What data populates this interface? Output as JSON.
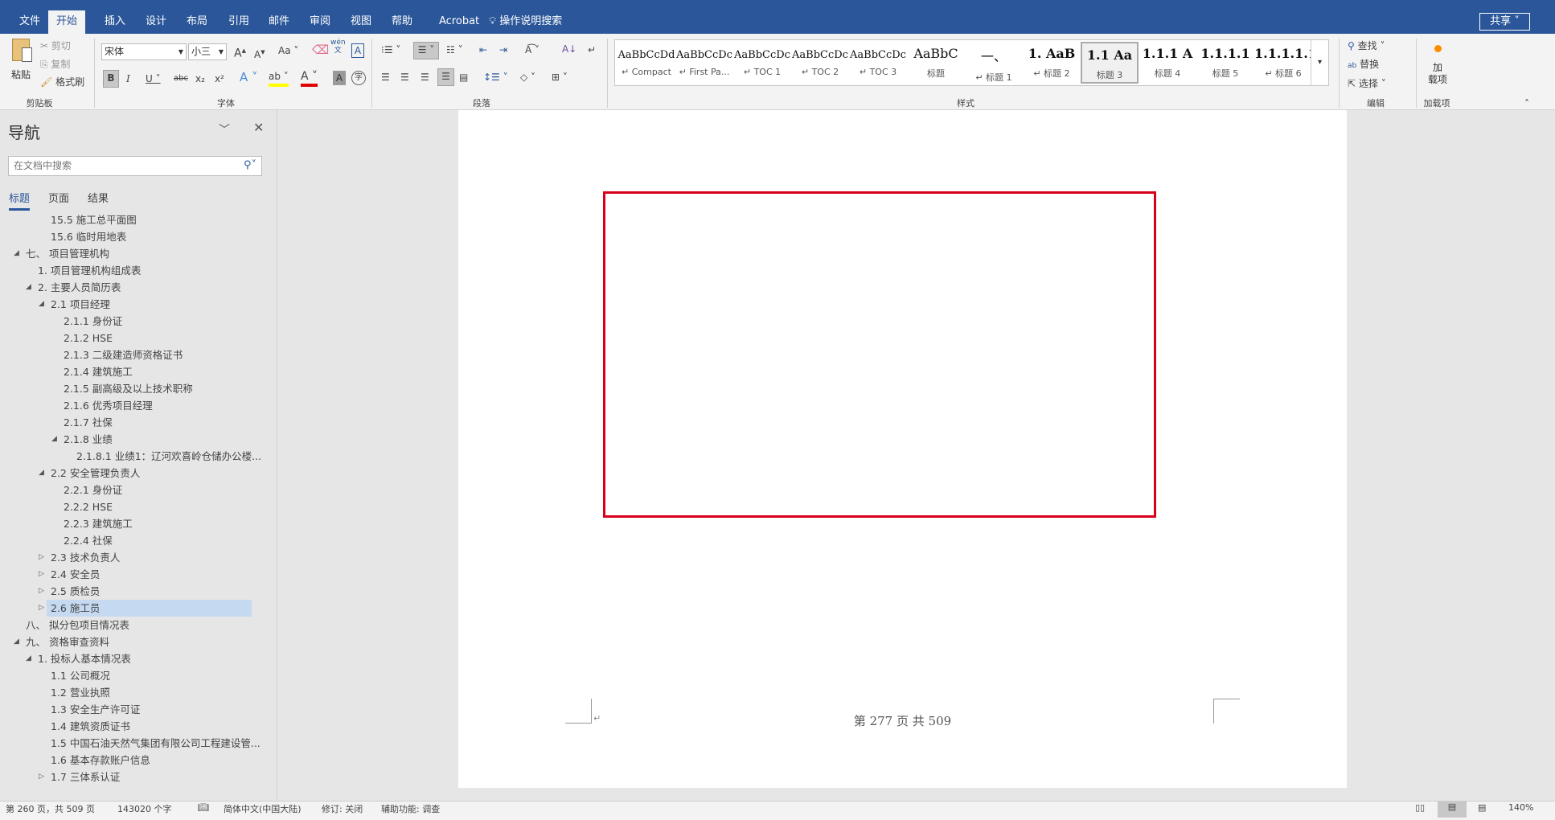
{
  "ribbon_tabs": [
    "文件",
    "开始",
    "插入",
    "设计",
    "布局",
    "引用",
    "邮件",
    "审阅",
    "视图",
    "帮助",
    "Acrobat"
  ],
  "active_tab": "开始",
  "tell_me": "操作说明搜索",
  "share": "共享",
  "clipboard": {
    "paste": "粘贴",
    "cut": "剪切",
    "copy": "复制",
    "format_painter": "格式刷",
    "label": "剪贴板"
  },
  "font": {
    "name": "宋体",
    "size": "小三",
    "change_case": "Aa",
    "label": "字体",
    "bold": "B",
    "italic": "I",
    "underline": "U",
    "strike": "abc",
    "sub": "x₂",
    "sup": "x²",
    "phonetic": "wén"
  },
  "paragraph": {
    "label": "段落"
  },
  "styles": {
    "label": "样式",
    "items": [
      {
        "preview": "AaBbCcDd",
        "label": "↵ Compact"
      },
      {
        "preview": "AaBbCcDc",
        "label": "↵ First Pa..."
      },
      {
        "preview": "AaBbCcDc",
        "label": "↵ TOC 1"
      },
      {
        "preview": "AaBbCcDc",
        "label": "↵ TOC 2"
      },
      {
        "preview": "AaBbCcDc",
        "label": "↵ TOC 3"
      },
      {
        "preview": "AaBbC",
        "label": "标题"
      },
      {
        "preview": "一、",
        "label": "↵ 标题 1"
      },
      {
        "preview": "1. AaB",
        "label": "↵ 标题 2"
      },
      {
        "preview": "1.1 Aa",
        "label": "标题 3"
      },
      {
        "preview": "1.1.1 A",
        "label": "标题 4"
      },
      {
        "preview": "1.1.1.1",
        "label": "标题 5"
      },
      {
        "preview": "1.1.1.1.1",
        "label": "↵ 标题 6"
      }
    ],
    "selected": 8
  },
  "editing": {
    "find": "查找",
    "replace": "替换",
    "select": "选择",
    "label": "编辑"
  },
  "addins": {
    "button_line1": "加",
    "button_line2": "载项",
    "label": "加载项",
    "accent": "#ff8c00"
  },
  "nav": {
    "title": "导航",
    "search_placeholder": "在文档中搜索",
    "tabs": [
      "标题",
      "页面",
      "结果"
    ],
    "active_tab": 0,
    "items": [
      {
        "t": "15.5 施工总平面图",
        "l": 3,
        "s": ""
      },
      {
        "t": "15.6 临时用地表",
        "l": 3,
        "s": ""
      },
      {
        "t": "七、  项目管理机构",
        "l": 1,
        "s": "e"
      },
      {
        "t": "1. 项目管理机构组成表",
        "l": 2,
        "s": ""
      },
      {
        "t": "2. 主要人员简历表",
        "l": 2,
        "s": "e"
      },
      {
        "t": "2.1 项目经理",
        "l": 3,
        "s": "e"
      },
      {
        "t": "2.1.1 身份证",
        "l": 4,
        "s": ""
      },
      {
        "t": "2.1.2 HSE",
        "l": 4,
        "s": ""
      },
      {
        "t": "2.1.3 二级建造师资格证书",
        "l": 4,
        "s": ""
      },
      {
        "t": "2.1.4 建筑施工",
        "l": 4,
        "s": ""
      },
      {
        "t": "2.1.5 副高级及以上技术职称",
        "l": 4,
        "s": ""
      },
      {
        "t": "2.1.6 优秀项目经理",
        "l": 4,
        "s": ""
      },
      {
        "t": "2.1.7 社保",
        "l": 4,
        "s": ""
      },
      {
        "t": "2.1.8 业绩",
        "l": 4,
        "s": "e"
      },
      {
        "t": "2.1.8.1 业绩1：辽河欢喜岭仓储办公楼...",
        "l": 5,
        "s": ""
      },
      {
        "t": "2.2 安全管理负责人",
        "l": 3,
        "s": "e"
      },
      {
        "t": "2.2.1 身份证",
        "l": 4,
        "s": ""
      },
      {
        "t": "2.2.2 HSE",
        "l": 4,
        "s": ""
      },
      {
        "t": "2.2.3 建筑施工",
        "l": 4,
        "s": ""
      },
      {
        "t": "2.2.4 社保",
        "l": 4,
        "s": ""
      },
      {
        "t": "2.3 技术负责人",
        "l": 3,
        "s": "c"
      },
      {
        "t": "2.4 安全员",
        "l": 3,
        "s": "c"
      },
      {
        "t": "2.5 质检员",
        "l": 3,
        "s": "c"
      },
      {
        "t": "2.6 施工员",
        "l": 3,
        "s": "c",
        "sel": true
      },
      {
        "t": "八、  拟分包项目情况表",
        "l": 1,
        "s": ""
      },
      {
        "t": "九、  资格审查资料",
        "l": 1,
        "s": "e"
      },
      {
        "t": "1. 投标人基本情况表",
        "l": 2,
        "s": "e"
      },
      {
        "t": "1.1 公司概况",
        "l": 3,
        "s": ""
      },
      {
        "t": "1.2 营业执照",
        "l": 3,
        "s": ""
      },
      {
        "t": "1.3 安全生产许可证",
        "l": 3,
        "s": ""
      },
      {
        "t": "1.4 建筑资质证书",
        "l": 3,
        "s": ""
      },
      {
        "t": "1.5 中国石油天然气集团有限公司工程建设管...",
        "l": 3,
        "s": ""
      },
      {
        "t": "1.6 基本存款账户信息",
        "l": 3,
        "s": ""
      },
      {
        "t": "1.7 三体系认证",
        "l": 3,
        "s": "c"
      }
    ]
  },
  "document": {
    "footer": "第 277 页 共 509",
    "frame_color": "#d9001b"
  },
  "status": {
    "page": "第 260 页，共 509 页",
    "words": "143020 个字",
    "language": "简体中文(中国大陆)",
    "track": "修订: 关闭",
    "accessibility": "辅助功能: 调查",
    "zoom": "140%"
  }
}
